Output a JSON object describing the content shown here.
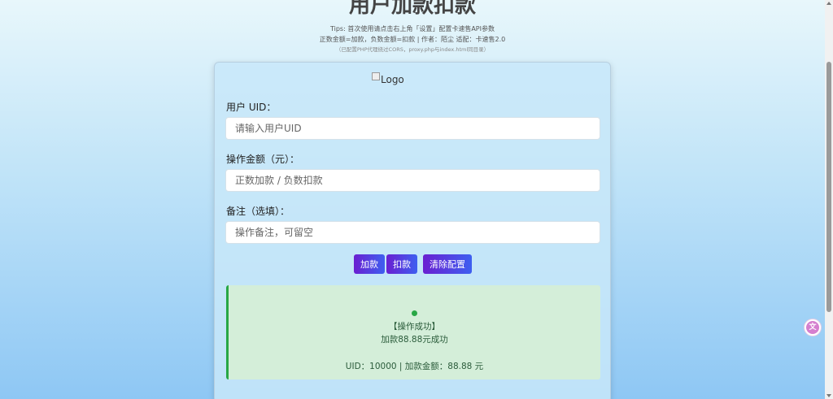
{
  "header": {
    "title": "用户加款扣款",
    "tips_line1": "Tips: 首次使用请点击右上角「设置」配置卡速售API参数",
    "tips_line2": "正数金额=加款，负数金额=扣款 | 作者：陌尘 适配：卡速售2.0",
    "tips_line3": "（已配置PHP代理绕过CORS，proxy.php与index.html同目录）"
  },
  "form": {
    "logo_alt": "Logo",
    "uid_label": "用户 UID：",
    "uid_placeholder": "请输入用户UID",
    "uid_value": "",
    "amount_label": "操作金额（元）：",
    "amount_placeholder": "正数加款 / 负数扣款",
    "amount_value": "",
    "note_label": "备注（选填）：",
    "note_placeholder": "操作备注，可留空",
    "note_value": ""
  },
  "buttons": {
    "add_label": "加款",
    "deduct_label": "扣款",
    "clear_label": "清除配置"
  },
  "result": {
    "status_icon": "success-dot-icon",
    "title": "【操作成功】",
    "message": "加款88.88元成功",
    "detail": "UID：10000 | 加款金额：88.88 元"
  },
  "colors": {
    "accent_gradient_start": "#6a1fd1",
    "accent_gradient_end": "#3e5ff0",
    "success": "#28a745",
    "success_bg": "#d4eed9"
  },
  "floating": {
    "translate_icon": "translate-icon",
    "translate_glyph": "文"
  }
}
